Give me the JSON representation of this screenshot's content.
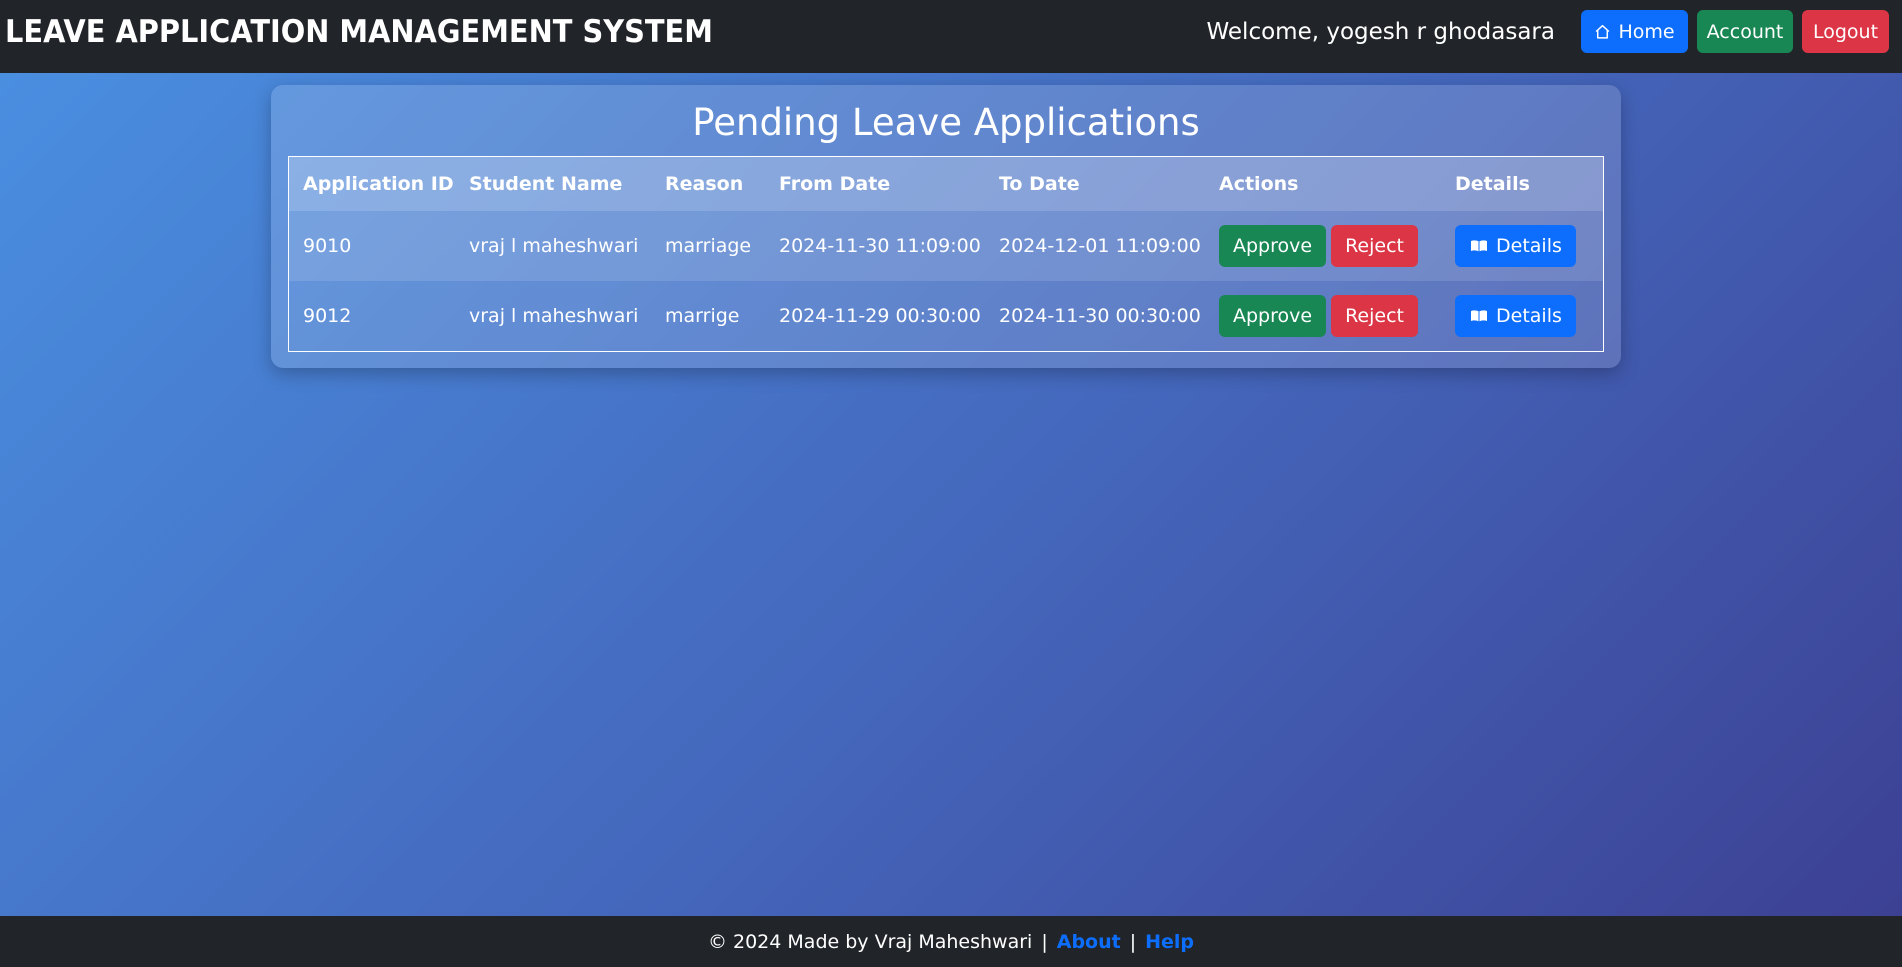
{
  "navbar": {
    "brand": "LEAVE APPLICATION MANAGEMENT SYSTEM",
    "welcome": "Welcome, yogesh r ghodasara",
    "home_label": "Home",
    "account_label": "Account",
    "logout_label": "Logout"
  },
  "main": {
    "title": "Pending Leave Applications",
    "columns": [
      "Application ID",
      "Student Name",
      "Reason",
      "From Date",
      "To Date",
      "Actions",
      "Details"
    ],
    "rows": [
      {
        "id": "9010",
        "student": "vraj l maheshwari",
        "reason": "marriage",
        "from": "2024-11-30 11:09:00",
        "to": "2024-12-01 11:09:00",
        "approve_label": "Approve",
        "reject_label": "Reject",
        "details_label": "Details"
      },
      {
        "id": "9012",
        "student": "vraj l maheshwari",
        "reason": "marrige",
        "from": "2024-11-29 00:30:00",
        "to": "2024-11-30 00:30:00",
        "approve_label": "Approve",
        "reject_label": "Reject",
        "details_label": "Details"
      }
    ]
  },
  "footer": {
    "copyright": "© 2024 Made by Vraj Maheshwari",
    "separator": "|",
    "about_label": "About",
    "help_label": "Help"
  },
  "icons": {
    "home": "home-icon",
    "details": "book-icon"
  },
  "colors": {
    "primary": "#0d6efd",
    "success": "#198754",
    "danger": "#dc3545",
    "navbar": "#212529"
  }
}
